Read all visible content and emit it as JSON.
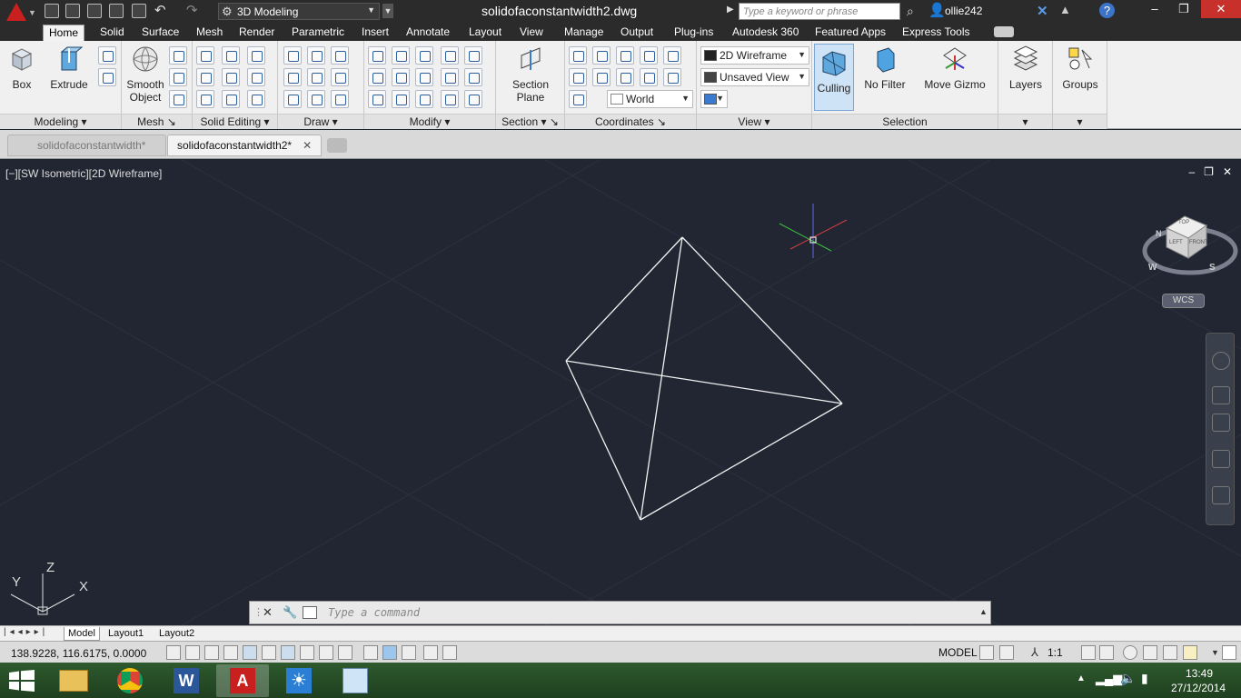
{
  "titlebar": {
    "workspace": "3D Modeling",
    "doc_title": "solidofaconstantwidth2.dwg",
    "search_placeholder": "Type a keyword or phrase",
    "user": "ollie242"
  },
  "ribbon_tabs": [
    "Home",
    "Solid",
    "Surface",
    "Mesh",
    "Render",
    "Parametric",
    "Insert",
    "Annotate",
    "Layout",
    "View",
    "Manage",
    "Output",
    "Plug-ins",
    "Autodesk 360",
    "Featured Apps",
    "Express Tools"
  ],
  "ribbon": {
    "box": "Box",
    "extrude": "Extrude",
    "smooth_object": [
      "Smooth",
      "Object"
    ],
    "section_plane": [
      "Section",
      "Plane"
    ],
    "visual_style": "2D Wireframe",
    "view": "Unsaved View",
    "ucs": "World",
    "culling": "Culling",
    "no_filter": "No Filter",
    "move_gizmo": "Move Gizmo",
    "layers": "Layers",
    "groups": "Groups",
    "panels": {
      "modeling": "Modeling",
      "mesh": "Mesh",
      "solid_editing": "Solid Editing",
      "draw": "Draw",
      "modify": "Modify",
      "section": "Section",
      "coordinates": "Coordinates",
      "view": "View",
      "selection": "Selection"
    }
  },
  "file_tabs": [
    {
      "label": "solidofaconstantwidth*",
      "active": false
    },
    {
      "label": "solidofaconstantwidth2*",
      "active": true
    }
  ],
  "viewport": {
    "label": "[−][SW Isometric][2D Wireframe]",
    "wcs": "WCS",
    "ucs_icon_x": "X",
    "ucs_icon_y": "Y",
    "ucs_icon_z": "Z",
    "viewcube_top": "TOP",
    "viewcube_left": "LEFT",
    "viewcube_front": "FRONT",
    "compass_w": "W",
    "compass_s": "S",
    "compass_n": "N"
  },
  "command_line": {
    "placeholder": "Type a command"
  },
  "layout_tabs": [
    "Model",
    "Layout1",
    "Layout2"
  ],
  "statusbar": {
    "coords": "138.9228, 116.6175, 0.0000",
    "model": "MODEL",
    "scale": "1:1"
  },
  "taskbar": {
    "time": "13:49",
    "date": "27/12/2014"
  }
}
